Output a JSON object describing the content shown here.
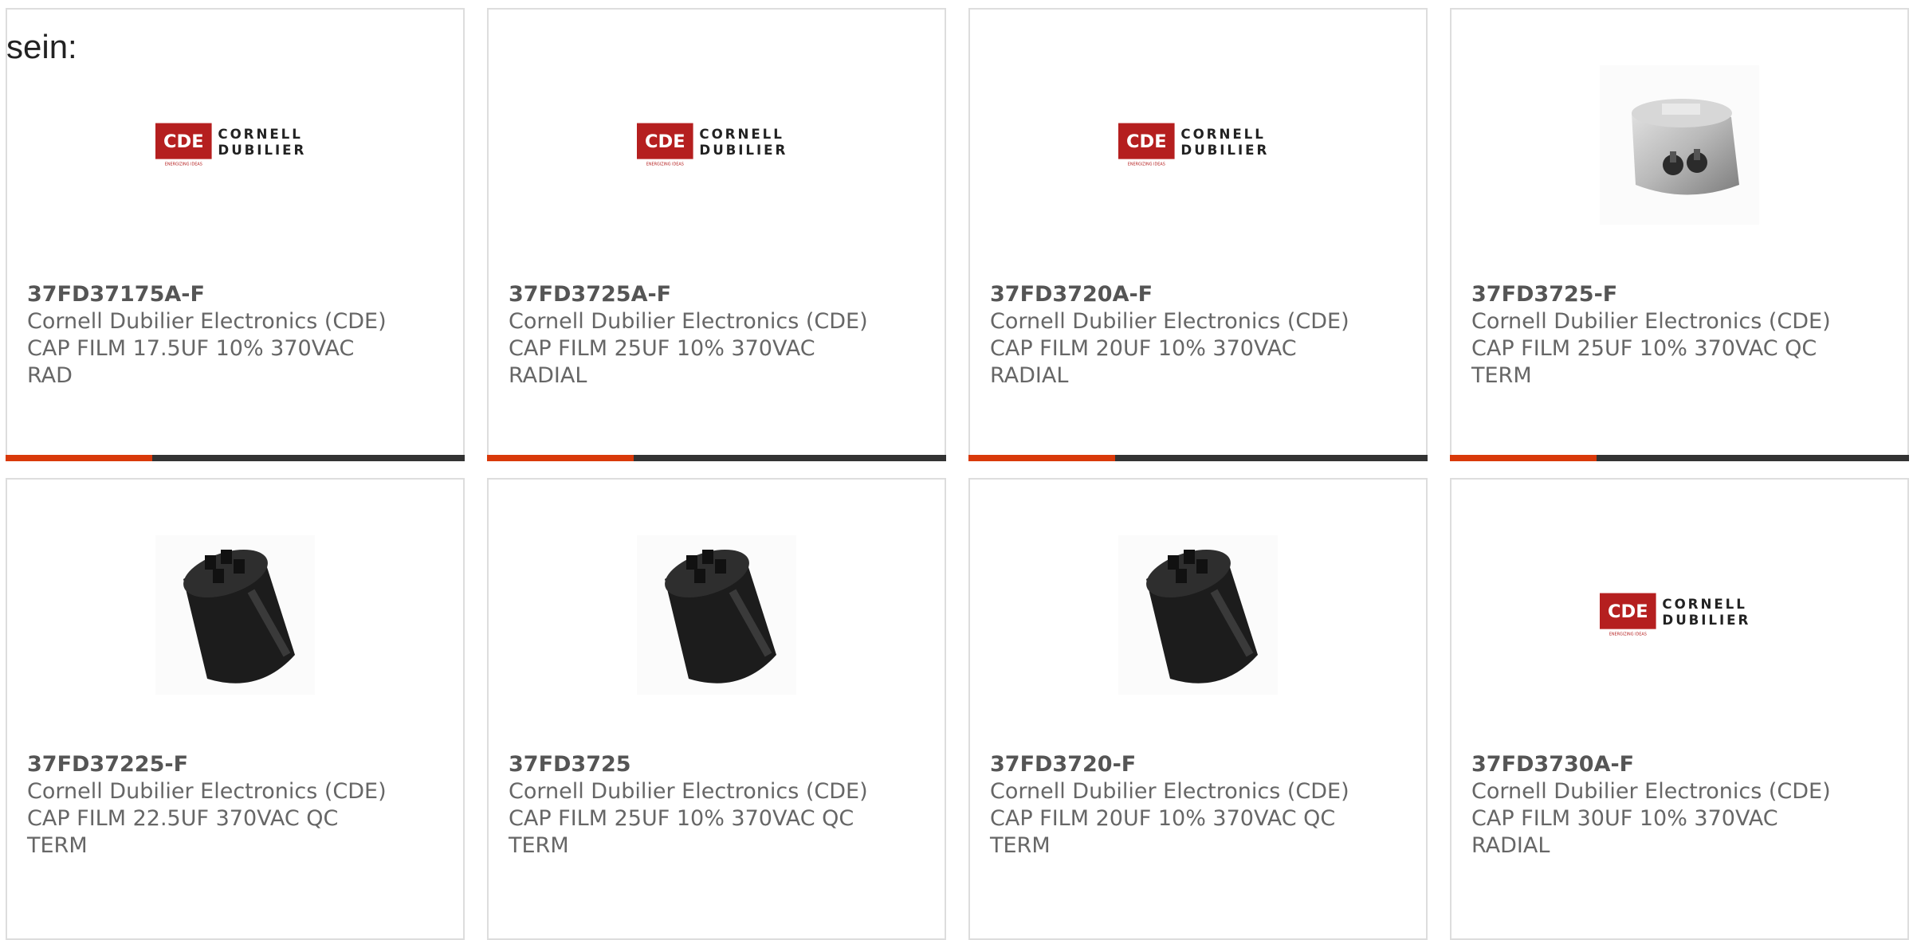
{
  "intro_text": "sein:",
  "colors": {
    "accent": "#d9390a",
    "bar": "#333333",
    "logo_red": "#b51f1f",
    "card_border": "#dddddd"
  },
  "products": [
    {
      "part_number": "37FD37175A-F",
      "manufacturer": "Cornell Dubilier Electronics (CDE)",
      "description": "CAP FILM 17.5UF 10% 370VAC RAD",
      "image": "cde-logo",
      "logo_line1": "CORNELL",
      "logo_line2": "DUBILIER",
      "logo_mark": "CDE",
      "logo_tagline": "ENERGIZING IDEAS"
    },
    {
      "part_number": "37FD3725A-F",
      "manufacturer": "Cornell Dubilier Electronics (CDE)",
      "description": "CAP FILM 25UF 10% 370VAC RADIAL",
      "image": "cde-logo",
      "logo_line1": "CORNELL",
      "logo_line2": "DUBILIER",
      "logo_mark": "CDE",
      "logo_tagline": "ENERGIZING IDEAS"
    },
    {
      "part_number": "37FD3720A-F",
      "manufacturer": "Cornell Dubilier Electronics (CDE)",
      "description": "CAP FILM 20UF 10% 370VAC RADIAL",
      "image": "cde-logo",
      "logo_line1": "CORNELL",
      "logo_line2": "DUBILIER",
      "logo_mark": "CDE",
      "logo_tagline": "ENERGIZING IDEAS"
    },
    {
      "part_number": "37FD3725-F",
      "manufacturer": "Cornell Dubilier Electronics (CDE)",
      "description": "CAP FILM 25UF 10% 370VAC QC TERM",
      "image": "oval-metal-capacitor"
    },
    {
      "part_number": "37FD37225-F",
      "manufacturer": "Cornell Dubilier Electronics (CDE)",
      "description": "CAP FILM 22.5UF 370VAC QC TERM",
      "image": "black-oval-capacitor"
    },
    {
      "part_number": "37FD3725",
      "manufacturer": "Cornell Dubilier Electronics (CDE)",
      "description": "CAP FILM 25UF 10% 370VAC QC TERM",
      "image": "black-oval-capacitor"
    },
    {
      "part_number": "37FD3720-F",
      "manufacturer": "Cornell Dubilier Electronics (CDE)",
      "description": "CAP FILM 20UF 10% 370VAC QC TERM",
      "image": "black-oval-capacitor"
    },
    {
      "part_number": "37FD3730A-F",
      "manufacturer": "Cornell Dubilier Electronics (CDE)",
      "description": "CAP FILM 30UF 10% 370VAC RADIAL",
      "image": "cde-logo",
      "logo_line1": "CORNELL",
      "logo_line2": "DUBILIER",
      "logo_mark": "CDE",
      "logo_tagline": "ENERGIZING IDEAS"
    }
  ]
}
